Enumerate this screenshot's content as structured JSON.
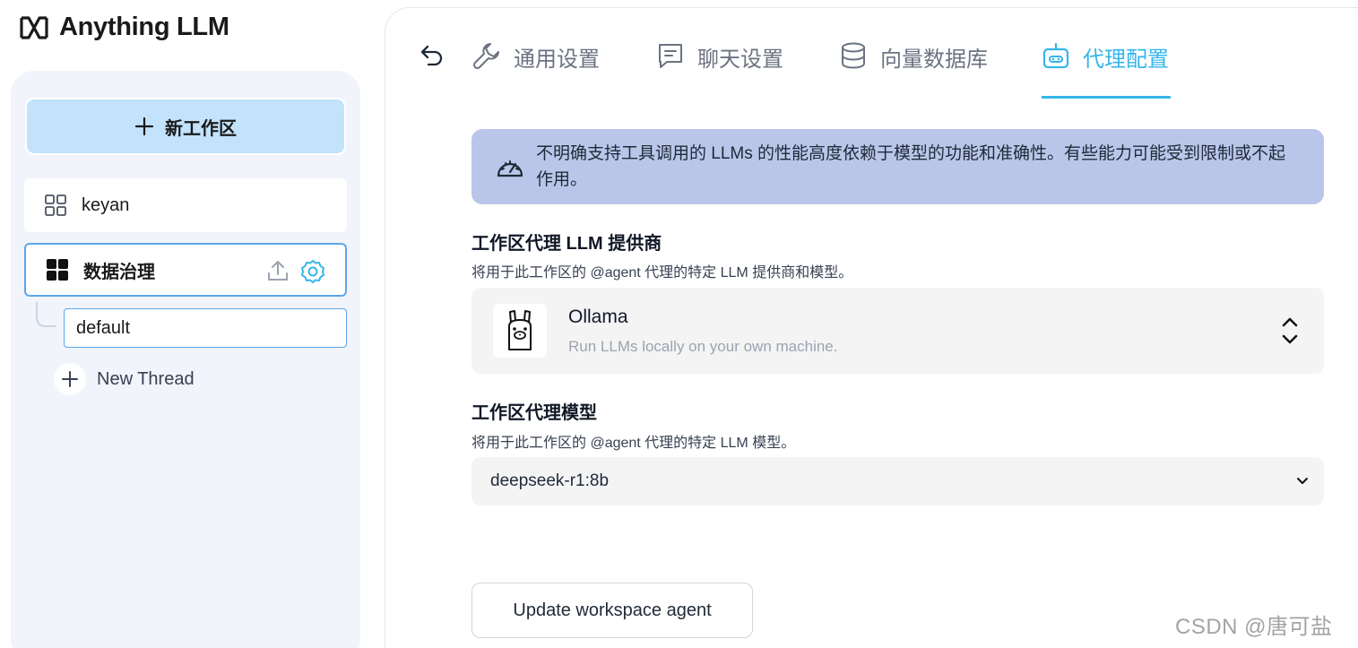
{
  "brand": {
    "name": "Anything LLM",
    "icon": "anythingllm-logo-icon"
  },
  "sidebar": {
    "new_workspace_label": "新工作区",
    "workspaces": [
      {
        "name": "keyan",
        "icon": "grid-outline-icon"
      },
      {
        "name": "数据治理",
        "icon": "grid-filled-icon",
        "active": true
      }
    ],
    "threads": [
      {
        "name": "default"
      }
    ],
    "new_thread_label": "New Thread"
  },
  "tabs": [
    {
      "label": "通用设置",
      "icon": "wrench-icon"
    },
    {
      "label": "聊天设置",
      "icon": "chat-icon"
    },
    {
      "label": "向量数据库",
      "icon": "database-icon"
    },
    {
      "label": "代理配置",
      "icon": "robot-icon",
      "active": true
    }
  ],
  "alert": {
    "text": "不明确支持工具调用的 LLMs 的性能高度依赖于模型的功能和准确性。有些能力可能受到限制或不起作用。",
    "icon": "gauge-icon"
  },
  "provider_section": {
    "title": "工作区代理 LLM 提供商",
    "description": "将用于此工作区的 @agent 代理的特定 LLM 提供商和模型。",
    "selected": {
      "name": "Ollama",
      "description": "Run LLMs locally on your own machine.",
      "icon": "ollama-llama-icon"
    }
  },
  "model_section": {
    "title": "工作区代理模型",
    "description": "将用于此工作区的 @agent 代理的特定 LLM 模型。",
    "selected": "deepseek-r1:8b"
  },
  "update_button_label": "Update workspace agent",
  "watermark": "CSDN @唐可盐",
  "colors": {
    "accent": "#34b6ea",
    "new_workspace_bg": "#c2e3fb",
    "alert_bg": "#bac6e9",
    "sidebar_bg": "#f1f4fb"
  }
}
